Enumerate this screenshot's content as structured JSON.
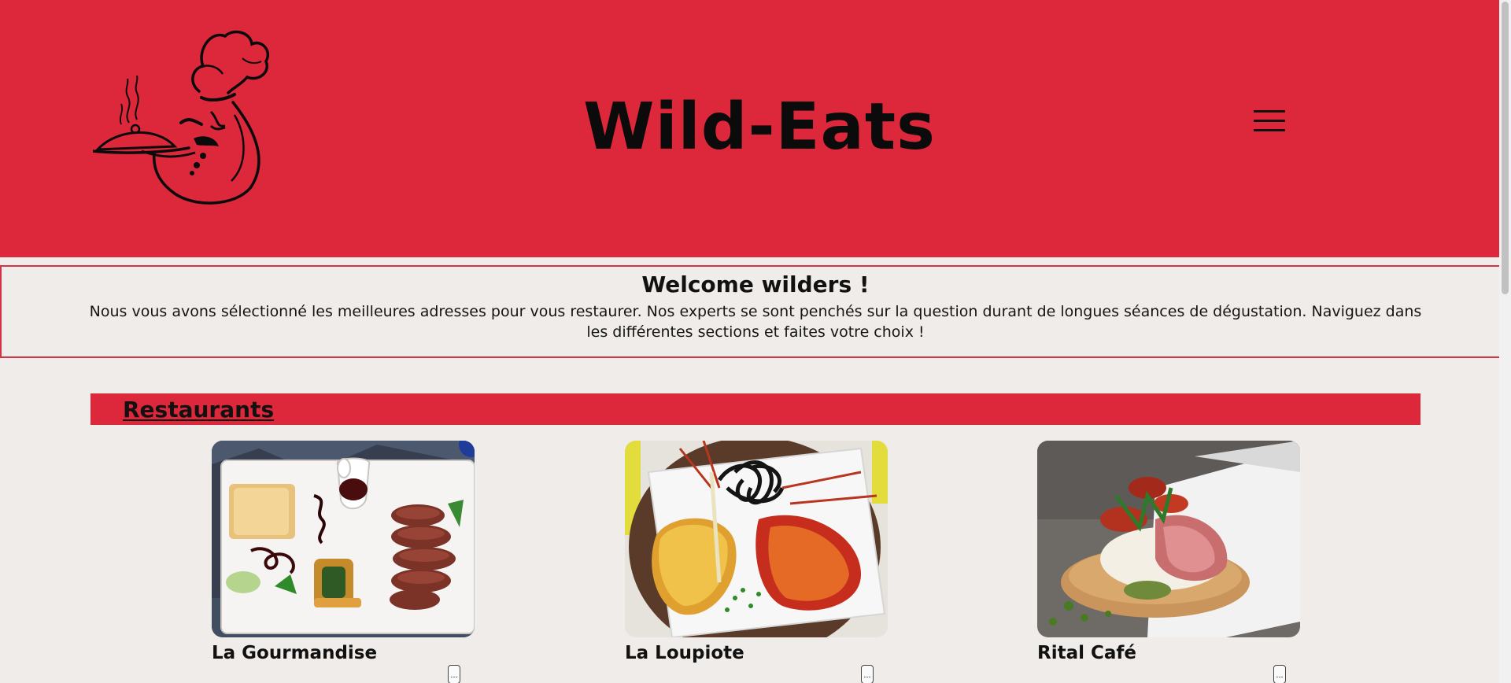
{
  "header": {
    "title": "Wild-Eats",
    "menu_icon": "hamburger-menu-icon",
    "brand_color": "#dc283a"
  },
  "welcome": {
    "heading": "Welcome wilders !",
    "text": "Nous vous avons sélectionné les meilleures adresses pour vous restaurer. Nos experts se sont penchés sur la question durant de longues séances de dégustation. Naviguez dans les différentes sections et faites votre choix !"
  },
  "section": {
    "title": "Restaurants"
  },
  "restaurants": [
    {
      "name": "La Gourmandise",
      "more_label": "..."
    },
    {
      "name": "La Loupiote",
      "more_label": "..."
    },
    {
      "name": "Rital Café",
      "more_label": "..."
    }
  ],
  "colors": {
    "accent": "#dc283a",
    "background": "#f0ece9",
    "welcome_border": "#d13447"
  }
}
